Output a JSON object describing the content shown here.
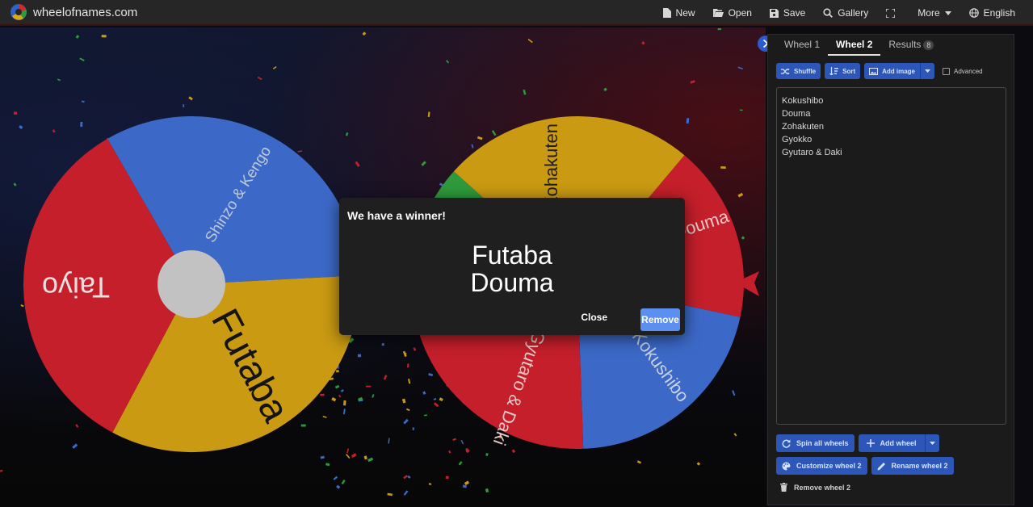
{
  "brand": {
    "name": "wheelofnames.com"
  },
  "nav": [
    {
      "label": "New",
      "icon": "file-icon"
    },
    {
      "label": "Open",
      "icon": "folder-open-icon"
    },
    {
      "label": "Save",
      "icon": "floppy-disk-icon"
    },
    {
      "label": "Gallery",
      "icon": "search-icon"
    },
    {
      "label": "",
      "icon": "fullscreen-icon"
    },
    {
      "label": "More",
      "icon": "chevron-down-icon"
    },
    {
      "label": "English",
      "icon": "globe-icon"
    }
  ],
  "wheel1": {
    "segments": [
      {
        "label": "Shinzo & Kengo",
        "color": "#3c69c8"
      },
      {
        "label": "Futaba",
        "color": "#c99a12"
      },
      {
        "label": "Taiyo",
        "color": "#c41f2a"
      }
    ]
  },
  "wheel2": {
    "segments": [
      {
        "label": "Douma",
        "color": "#c41f2a"
      },
      {
        "label": "Kokushibo",
        "color": "#3c69c8"
      },
      {
        "label": "Gyutaro & Daki",
        "color": "#c41f2a"
      },
      {
        "label": "Gyokko",
        "color": "#2e9a3c"
      },
      {
        "label": "Zohakuten",
        "color": "#c99a12"
      }
    ]
  },
  "dialog": {
    "title": "We have a winner!",
    "winner_line1": "Futaba",
    "winner_line2": "Douma",
    "close_label": "Close",
    "remove_label": "Remove"
  },
  "panel": {
    "tabs": [
      {
        "label": "Wheel 1"
      },
      {
        "label": "Wheel 2"
      },
      {
        "label": "Results",
        "badge": "8"
      }
    ],
    "tools": {
      "shuffle": "Shuffle",
      "sort": "Sort",
      "add_image": "Add image",
      "advanced": "Advanced"
    },
    "entries": [
      "Kokushibo",
      "Douma",
      "Zohakuten",
      "Gyokko",
      "Gyutaro & Daki"
    ],
    "actions": {
      "spin_all": "Spin all wheels",
      "add_wheel": "Add wheel",
      "customize": "Customize wheel 2",
      "rename": "Rename wheel 2",
      "remove_wheel": "Remove wheel 2"
    }
  },
  "colors": {
    "accent": "#2c56b8",
    "remove_button": "#5b8ff0",
    "red": "#c41f2a",
    "blue": "#3c69c8",
    "yellow": "#c99a12",
    "green": "#2e9a3c"
  }
}
